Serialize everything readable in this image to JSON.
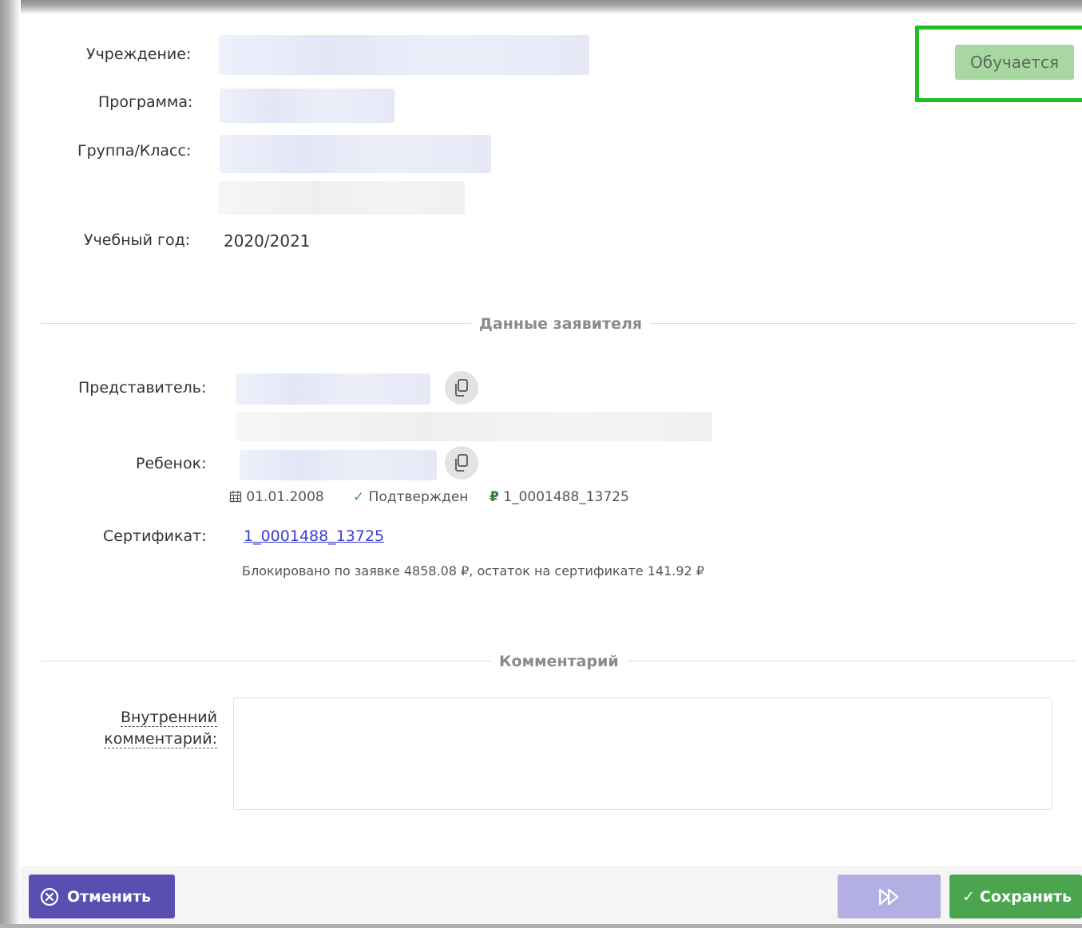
{
  "status": {
    "label": "Обучается",
    "highlight_color": "#1fbf1f",
    "badge_color": "#a7d8a2"
  },
  "fields": {
    "institution_label": "Учреждение:",
    "program_label": "Программа:",
    "group_label": "Группа/Класс:",
    "year_label": "Учебный год:",
    "year_value": "2020/2021"
  },
  "sections": {
    "applicant_title": "Данные заявителя",
    "comment_title": "Комментарий"
  },
  "applicant": {
    "representative_label": "Представитель:",
    "child_label": "Ребенок:",
    "birth_date": "01.01.2008",
    "confirmed_text": "Подтвержден",
    "certificate_code": "1_0001488_13725",
    "certificate_label": "Сертификат:",
    "certificate_link": "1_0001488_13725",
    "certificate_note": "Блокировано по заявке 4858.08 ₽, остаток на сертификате 141.92 ₽"
  },
  "comment": {
    "label_line1": "Внутренний",
    "label_line2": "комментарий:",
    "value": ""
  },
  "footer": {
    "cancel_label": "Отменить",
    "save_label": "Сохранить",
    "cancel_color": "#5a4fb0",
    "next_color": "#b4afe3",
    "save_color": "#4aa54e"
  },
  "icons": {
    "copy": "copy-icon",
    "calendar": "calendar-icon",
    "check": "check-icon",
    "ruble": "ruble-icon",
    "cancel": "close-circle-icon",
    "next": "fast-forward-icon",
    "save": "check-icon"
  }
}
